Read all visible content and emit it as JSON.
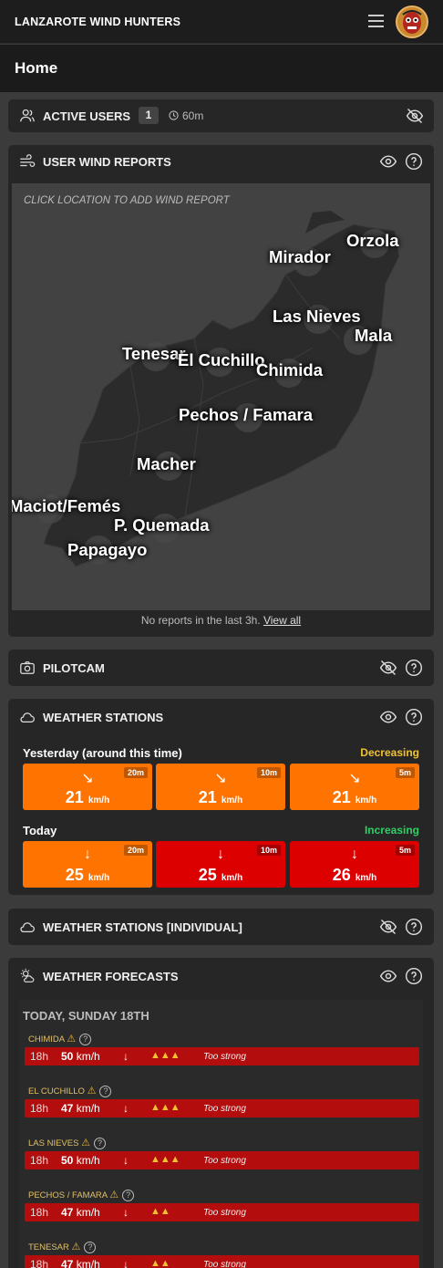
{
  "header": {
    "title": "LANZAROTE WIND HUNTERS",
    "menu_icon": "hamburger-icon",
    "avatar_icon": "avatar"
  },
  "page": {
    "title": "Home"
  },
  "active_users": {
    "title": "ACTIVE USERS",
    "count": "1",
    "window": "60m"
  },
  "wind_reports": {
    "title": "USER WIND REPORTS",
    "hint": "CLICK LOCATION TO ADD WIND REPORT",
    "locations": [
      "Orzola",
      "Mirador",
      "Las Nieves",
      "Mala",
      "Tenesar",
      "El Cuchillo",
      "Chimida",
      "Pechos / Famara",
      "Macher",
      "Maciot/Femés",
      "P. Quemada",
      "Papagayo"
    ],
    "footer_text": "No reports in the last 3h.",
    "footer_link": "View all"
  },
  "pilotcam": {
    "title": "PILOTCAM"
  },
  "weather_stations": {
    "title": "WEATHER STATIONS",
    "yesterday": {
      "label": "Yesterday (around this time)",
      "trend": "Decreasing",
      "tiles": [
        {
          "tag": "20m",
          "arrow": "↘",
          "value": "21",
          "unit": "km/h"
        },
        {
          "tag": "10m",
          "arrow": "↘",
          "value": "21",
          "unit": "km/h"
        },
        {
          "tag": "5m",
          "arrow": "↘",
          "value": "21",
          "unit": "km/h"
        }
      ]
    },
    "today": {
      "label": "Today",
      "trend": "Increasing",
      "tiles": [
        {
          "tag": "20m",
          "arrow": "↓",
          "value": "25",
          "unit": "km/h"
        },
        {
          "tag": "10m",
          "arrow": "↓",
          "value": "25",
          "unit": "km/h"
        },
        {
          "tag": "5m",
          "arrow": "↓",
          "value": "26",
          "unit": "km/h"
        }
      ]
    },
    "colors": {
      "orange": "#ff7400",
      "red": "#dc0000",
      "decreasing": "#f0c230",
      "increasing": "#2fcf66"
    }
  },
  "weather_stations_individual": {
    "title": "WEATHER STATIONS [INDIVIDUAL]"
  },
  "forecasts": {
    "title": "WEATHER FORECASTS",
    "day": "TODAY, SUNDAY 18TH",
    "rows": [
      {
        "spot": "CHIMIDA",
        "hour": "18h",
        "speed": "50",
        "unit": "km/h",
        "dir": "↓",
        "warnings": "▲▲▲",
        "note": "Too strong"
      },
      {
        "spot": "EL CUCHILLO",
        "hour": "18h",
        "speed": "47",
        "unit": "km/h",
        "dir": "↓",
        "warnings": "▲▲▲",
        "note": "Too strong"
      },
      {
        "spot": "LAS NIEVES",
        "hour": "18h",
        "speed": "50",
        "unit": "km/h",
        "dir": "↓",
        "warnings": "▲▲▲",
        "note": "Too strong"
      },
      {
        "spot": "PECHOS / FAMARA",
        "hour": "18h",
        "speed": "47",
        "unit": "km/h",
        "dir": "↓",
        "warnings": "▲▲",
        "note": "Too strong"
      },
      {
        "spot": "TENESAR",
        "hour": "18h",
        "speed": "47",
        "unit": "km/h",
        "dir": "↓",
        "warnings": "▲▲",
        "note": "Too strong"
      }
    ]
  }
}
